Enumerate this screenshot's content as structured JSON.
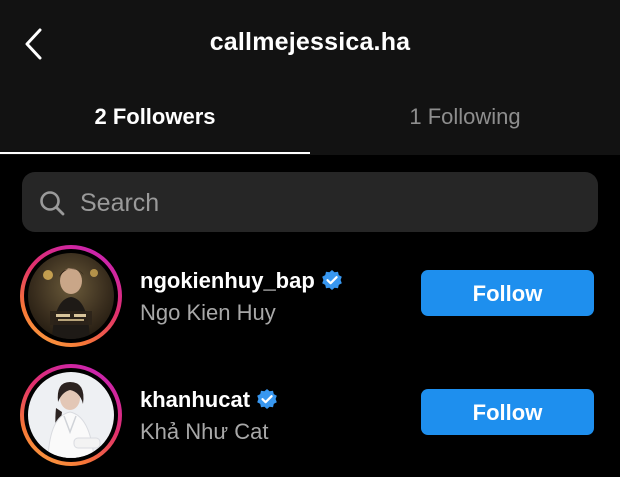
{
  "header": {
    "title": "callmejessica.ha",
    "back_icon": "chevron-left-icon"
  },
  "tabs": [
    {
      "label": "2 Followers",
      "active": true
    },
    {
      "label": "1 Following",
      "active": false
    }
  ],
  "search": {
    "placeholder": "Search",
    "value": "",
    "icon": "search-icon"
  },
  "followers": [
    {
      "username": "ngokienhuy_bap",
      "full_name": "Ngo Kien Huy",
      "verified": true,
      "button_label": "Follow"
    },
    {
      "username": "khanhucat",
      "full_name": "Khả Như Cat",
      "verified": true,
      "button_label": "Follow"
    }
  ],
  "colors": {
    "background": "#000000",
    "header_background": "#121212",
    "follow_button": "#1e8fee",
    "verified_badge": "#3897f0",
    "search_background": "#262626"
  }
}
